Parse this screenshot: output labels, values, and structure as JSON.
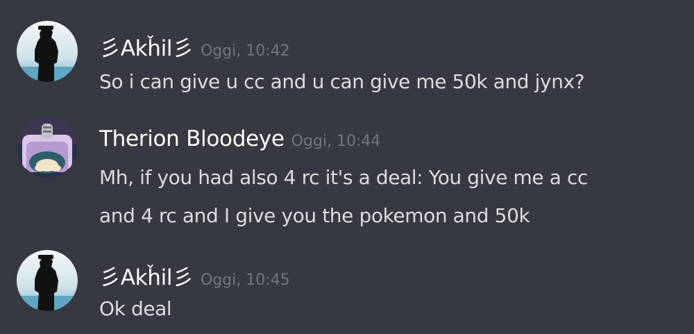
{
  "messages": [
    {
      "author": "彡Akȟil彡",
      "timestamp": "Oggi, 10:42",
      "avatar_icon": "silhouette-avatar",
      "lines": [
        "So i can give u cc and u can give me 50k and jynx?"
      ]
    },
    {
      "author": "Therion Bloodeye",
      "timestamp": "Oggi, 10:44",
      "avatar_icon": "snorlax-avatar",
      "lines": [
        "Mh, if you had also 4 rc it's a deal: You give me a cc",
        "and 4 rc and I give you the pokemon and 50k"
      ]
    },
    {
      "author": "彡Akȟil彡",
      "timestamp": "Oggi, 10:45",
      "avatar_icon": "silhouette-avatar",
      "lines": [
        "Ok deal"
      ]
    }
  ],
  "colors": {
    "background": "#36393f",
    "username": "#ffffff",
    "timestamp": "#72767d",
    "message_text": "#dcddde"
  }
}
